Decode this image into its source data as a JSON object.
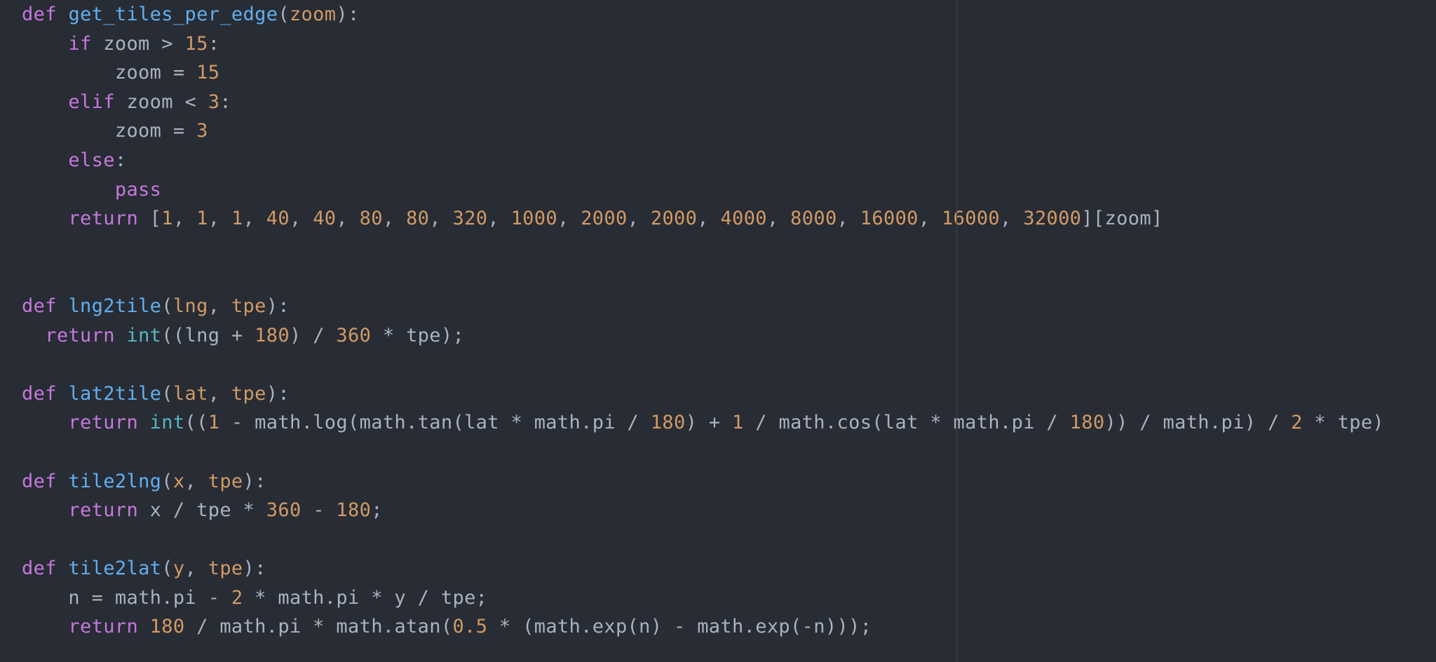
{
  "editor": {
    "language": "python",
    "theme": "one-dark",
    "colors": {
      "background": "#282c34",
      "keyword": "#c678dd",
      "function": "#61afef",
      "param": "#d19a66",
      "number": "#d19a66",
      "builtin": "#56b6c2",
      "plain": "#abb2bf",
      "wrap_guide": "#3b4048"
    },
    "lines": [
      [
        [
          "keyword",
          "def"
        ],
        [
          "plain",
          " "
        ],
        [
          "function",
          "get_tiles_per_edge"
        ],
        [
          "punct",
          "("
        ],
        [
          "param",
          "zoom"
        ],
        [
          "punct",
          "):"
        ]
      ],
      [
        [
          "plain",
          "    "
        ],
        [
          "keyword",
          "if"
        ],
        [
          "plain",
          " zoom "
        ],
        [
          "operator",
          ">"
        ],
        [
          "plain",
          " "
        ],
        [
          "number",
          "15"
        ],
        [
          "punct",
          ":"
        ]
      ],
      [
        [
          "plain",
          "        zoom "
        ],
        [
          "operator",
          "="
        ],
        [
          "plain",
          " "
        ],
        [
          "number",
          "15"
        ]
      ],
      [
        [
          "plain",
          "    "
        ],
        [
          "keyword",
          "elif"
        ],
        [
          "plain",
          " zoom "
        ],
        [
          "operator",
          "<"
        ],
        [
          "plain",
          " "
        ],
        [
          "number",
          "3"
        ],
        [
          "punct",
          ":"
        ]
      ],
      [
        [
          "plain",
          "        zoom "
        ],
        [
          "operator",
          "="
        ],
        [
          "plain",
          " "
        ],
        [
          "number",
          "3"
        ]
      ],
      [
        [
          "plain",
          "    "
        ],
        [
          "keyword",
          "else"
        ],
        [
          "punct",
          ":"
        ]
      ],
      [
        [
          "plain",
          "        "
        ],
        [
          "keyword",
          "pass"
        ]
      ],
      [
        [
          "plain",
          "    "
        ],
        [
          "keyword",
          "return"
        ],
        [
          "plain",
          " "
        ],
        [
          "punct",
          "["
        ],
        [
          "number",
          "1"
        ],
        [
          "punct",
          ", "
        ],
        [
          "number",
          "1"
        ],
        [
          "punct",
          ", "
        ],
        [
          "number",
          "1"
        ],
        [
          "punct",
          ", "
        ],
        [
          "number",
          "40"
        ],
        [
          "punct",
          ", "
        ],
        [
          "number",
          "40"
        ],
        [
          "punct",
          ", "
        ],
        [
          "number",
          "80"
        ],
        [
          "punct",
          ", "
        ],
        [
          "number",
          "80"
        ],
        [
          "punct",
          ", "
        ],
        [
          "number",
          "320"
        ],
        [
          "punct",
          ", "
        ],
        [
          "number",
          "1000"
        ],
        [
          "punct",
          ", "
        ],
        [
          "number",
          "2000"
        ],
        [
          "punct",
          ", "
        ],
        [
          "number",
          "2000"
        ],
        [
          "punct",
          ", "
        ],
        [
          "number",
          "4000"
        ],
        [
          "punct",
          ", "
        ],
        [
          "number",
          "8000"
        ],
        [
          "punct",
          ", "
        ],
        [
          "number",
          "16000"
        ],
        [
          "punct",
          ", "
        ],
        [
          "number",
          "16000"
        ],
        [
          "punct",
          ", "
        ],
        [
          "number",
          "32000"
        ],
        [
          "punct",
          "]["
        ],
        [
          "plain",
          "zoom"
        ],
        [
          "punct",
          "]"
        ]
      ],
      [],
      [],
      [
        [
          "keyword",
          "def"
        ],
        [
          "plain",
          " "
        ],
        [
          "function",
          "lng2tile"
        ],
        [
          "punct",
          "("
        ],
        [
          "param",
          "lng"
        ],
        [
          "punct",
          ", "
        ],
        [
          "param",
          "tpe"
        ],
        [
          "punct",
          "):"
        ]
      ],
      [
        [
          "plain",
          "  "
        ],
        [
          "keyword",
          "return"
        ],
        [
          "plain",
          " "
        ],
        [
          "builtin",
          "int"
        ],
        [
          "punct",
          "(("
        ],
        [
          "plain",
          "lng "
        ],
        [
          "operator",
          "+"
        ],
        [
          "plain",
          " "
        ],
        [
          "number",
          "180"
        ],
        [
          "punct",
          ")"
        ],
        [
          "plain",
          " "
        ],
        [
          "operator",
          "/"
        ],
        [
          "plain",
          " "
        ],
        [
          "number",
          "360"
        ],
        [
          "plain",
          " "
        ],
        [
          "operator",
          "*"
        ],
        [
          "plain",
          " tpe"
        ],
        [
          "punct",
          ");"
        ]
      ],
      [],
      [
        [
          "keyword",
          "def"
        ],
        [
          "plain",
          " "
        ],
        [
          "function",
          "lat2tile"
        ],
        [
          "punct",
          "("
        ],
        [
          "param",
          "lat"
        ],
        [
          "punct",
          ", "
        ],
        [
          "param",
          "tpe"
        ],
        [
          "punct",
          "):"
        ]
      ],
      [
        [
          "plain",
          "    "
        ],
        [
          "keyword",
          "return"
        ],
        [
          "plain",
          " "
        ],
        [
          "builtin",
          "int"
        ],
        [
          "punct",
          "(("
        ],
        [
          "number",
          "1"
        ],
        [
          "plain",
          " "
        ],
        [
          "operator",
          "-"
        ],
        [
          "plain",
          " math.log(math.tan(lat "
        ],
        [
          "operator",
          "*"
        ],
        [
          "plain",
          " math.pi "
        ],
        [
          "operator",
          "/"
        ],
        [
          "plain",
          " "
        ],
        [
          "number",
          "180"
        ],
        [
          "punct",
          ")"
        ],
        [
          "plain",
          " "
        ],
        [
          "operator",
          "+"
        ],
        [
          "plain",
          " "
        ],
        [
          "number",
          "1"
        ],
        [
          "plain",
          " "
        ],
        [
          "operator",
          "/"
        ],
        [
          "plain",
          " math.cos(lat "
        ],
        [
          "operator",
          "*"
        ],
        [
          "plain",
          " math.pi "
        ],
        [
          "operator",
          "/"
        ],
        [
          "plain",
          " "
        ],
        [
          "number",
          "180"
        ],
        [
          "punct",
          "))"
        ],
        [
          "plain",
          " "
        ],
        [
          "operator",
          "/"
        ],
        [
          "plain",
          " math.pi"
        ],
        [
          "punct",
          ")"
        ],
        [
          "plain",
          " "
        ],
        [
          "operator",
          "/"
        ],
        [
          "plain",
          " "
        ],
        [
          "number",
          "2"
        ],
        [
          "plain",
          " "
        ],
        [
          "operator",
          "*"
        ],
        [
          "plain",
          " tpe"
        ],
        [
          "punct",
          ")"
        ]
      ],
      [],
      [
        [
          "keyword",
          "def"
        ],
        [
          "plain",
          " "
        ],
        [
          "function",
          "tile2lng"
        ],
        [
          "punct",
          "("
        ],
        [
          "param",
          "x"
        ],
        [
          "punct",
          ", "
        ],
        [
          "param",
          "tpe"
        ],
        [
          "punct",
          "):"
        ]
      ],
      [
        [
          "plain",
          "    "
        ],
        [
          "keyword",
          "return"
        ],
        [
          "plain",
          " x "
        ],
        [
          "operator",
          "/"
        ],
        [
          "plain",
          " tpe "
        ],
        [
          "operator",
          "*"
        ],
        [
          "plain",
          " "
        ],
        [
          "number",
          "360"
        ],
        [
          "plain",
          " "
        ],
        [
          "operator",
          "-"
        ],
        [
          "plain",
          " "
        ],
        [
          "number",
          "180"
        ],
        [
          "punct",
          ";"
        ]
      ],
      [],
      [
        [
          "keyword",
          "def"
        ],
        [
          "plain",
          " "
        ],
        [
          "function",
          "tile2lat"
        ],
        [
          "punct",
          "("
        ],
        [
          "param",
          "y"
        ],
        [
          "punct",
          ", "
        ],
        [
          "param",
          "tpe"
        ],
        [
          "punct",
          "):"
        ]
      ],
      [
        [
          "plain",
          "    n "
        ],
        [
          "operator",
          "="
        ],
        [
          "plain",
          " math.pi "
        ],
        [
          "operator",
          "-"
        ],
        [
          "plain",
          " "
        ],
        [
          "number",
          "2"
        ],
        [
          "plain",
          " "
        ],
        [
          "operator",
          "*"
        ],
        [
          "plain",
          " math.pi "
        ],
        [
          "operator",
          "*"
        ],
        [
          "plain",
          " y "
        ],
        [
          "operator",
          "/"
        ],
        [
          "plain",
          " tpe"
        ],
        [
          "punct",
          ";"
        ]
      ],
      [
        [
          "plain",
          "    "
        ],
        [
          "keyword",
          "return"
        ],
        [
          "plain",
          " "
        ],
        [
          "number",
          "180"
        ],
        [
          "plain",
          " "
        ],
        [
          "operator",
          "/"
        ],
        [
          "plain",
          " math.pi "
        ],
        [
          "operator",
          "*"
        ],
        [
          "plain",
          " math.atan("
        ],
        [
          "number",
          "0.5"
        ],
        [
          "plain",
          " "
        ],
        [
          "operator",
          "*"
        ],
        [
          "plain",
          " (math.exp(n) "
        ],
        [
          "operator",
          "-"
        ],
        [
          "plain",
          " math.exp("
        ],
        [
          "operator",
          "-"
        ],
        [
          "plain",
          "n)))"
        ],
        [
          "punct",
          ";"
        ]
      ]
    ]
  }
}
